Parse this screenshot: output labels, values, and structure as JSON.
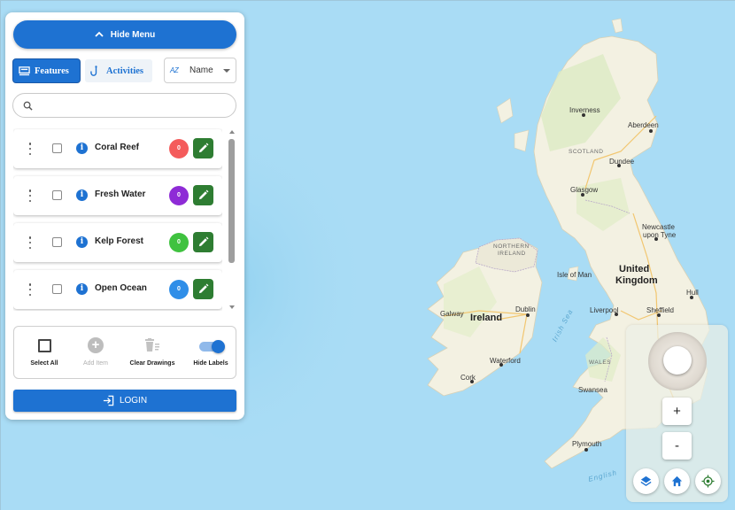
{
  "header": {
    "hide_menu_label": "Hide Menu"
  },
  "tabs": [
    {
      "label": "Features",
      "icon": "features-icon",
      "active": true
    },
    {
      "label": "Activities",
      "icon": "hook-icon",
      "active": false
    }
  ],
  "sort": {
    "icon_text": "AZ",
    "selected": "Name"
  },
  "search": {
    "placeholder": "",
    "value": ""
  },
  "features": [
    {
      "name": "Coral Reef",
      "count": "0",
      "color": "#f45b5b"
    },
    {
      "name": "Fresh Water",
      "count": "0",
      "color": "#8e2bd6"
    },
    {
      "name": "Kelp Forest",
      "count": "0",
      "color": "#3fc23f"
    },
    {
      "name": "Open Ocean",
      "count": "0",
      "color": "#2f8ee8"
    }
  ],
  "actions": {
    "select_all": "Select All",
    "add_item": "Add Item",
    "clear_drawings": "Clear Drawings",
    "hide_labels": "Hide Labels"
  },
  "login_label": "LOGIN",
  "map_controls": {
    "zoom_in": "+",
    "zoom_out": "-"
  },
  "map_labels": {
    "inverness": "Inverness",
    "aberdeen": "Aberdeen",
    "scotland": "SCOTLAND",
    "dundee": "Dundee",
    "glasgow": "Glasgow",
    "northern_ireland_1": "NORTHERN",
    "northern_ireland_2": "IRELAND",
    "isle_of_man": "Isle of Man",
    "united_kingdom_1": "United",
    "united_kingdom_2": "Kingdom",
    "newcastle_1": "Newcastle",
    "newcastle_2": "upon Tyne",
    "hull": "Hull",
    "galway": "Galway",
    "ireland": "Ireland",
    "dublin": "Dublin",
    "irish_sea": "Irish Sea",
    "liverpool": "Liverpool",
    "sheffield": "Sheffield",
    "wales": "WALES",
    "waterford": "Waterford",
    "cork": "Cork",
    "swansea": "Swansea",
    "plymouth": "Plymouth",
    "english_channel": "English"
  },
  "colors": {
    "accent": "#1e72d2",
    "edit_green": "#2e7d32",
    "sea": "#a9dcf5",
    "land": "#f3f1e2"
  }
}
